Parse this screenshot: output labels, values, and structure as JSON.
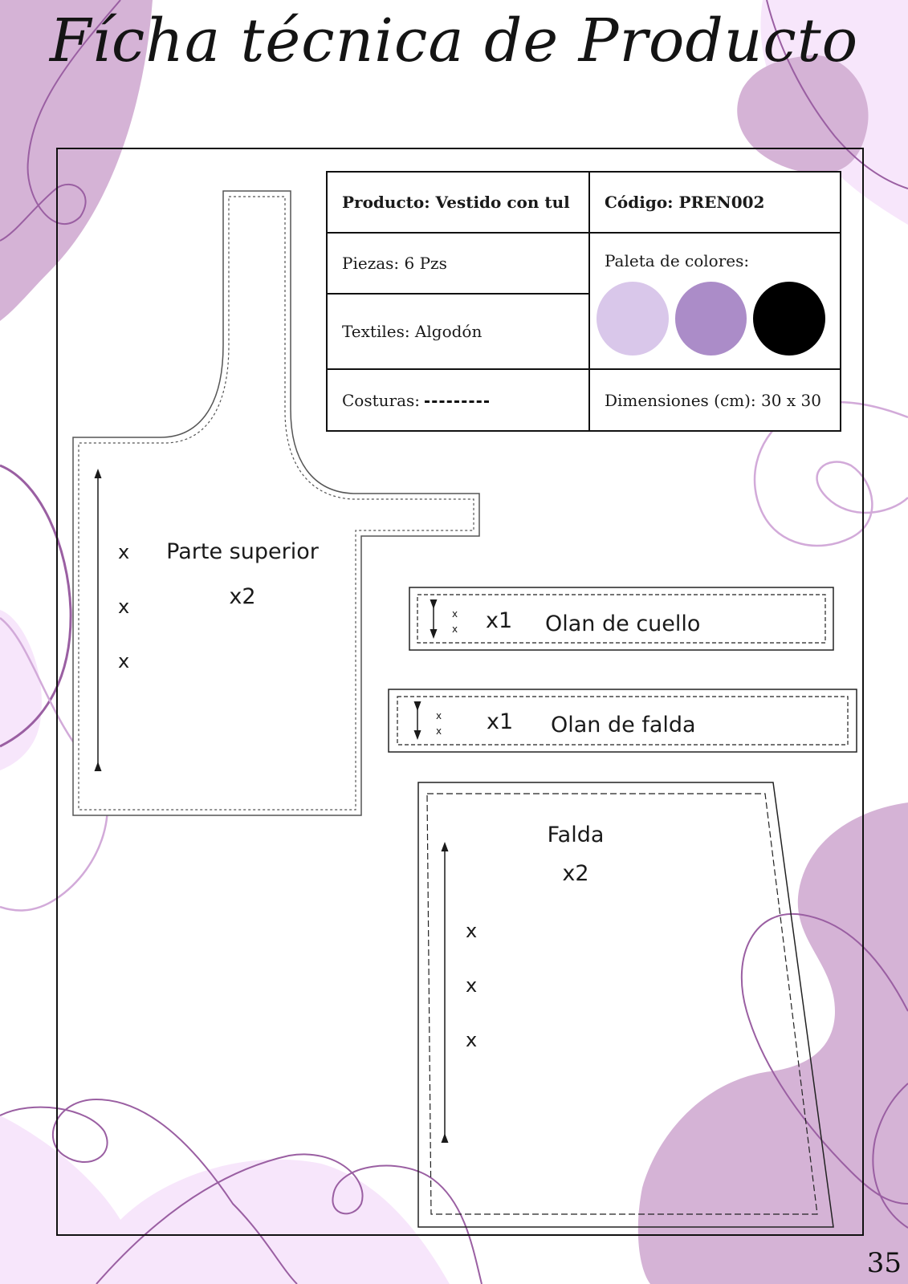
{
  "title": "Fícha técnica de Producto",
  "spec": {
    "producto": "Producto: Vestido con tul",
    "codigo": "Código: PREN002",
    "piezas": "Piezas: 6 Pzs",
    "paleta_label": "Paleta de colores:",
    "textiles": "Textiles: Algodón",
    "costuras": "Costuras:",
    "dimensiones": "Dimensiones (cm): 30 x 30",
    "palette": [
      "#d9c7ea",
      "#ab8cc8",
      "#000000"
    ]
  },
  "pieces": {
    "top": {
      "name": "Parte superior",
      "qty": "x2",
      "marks": [
        "x",
        "x",
        "x"
      ]
    },
    "collar_ruffle": {
      "name": "Olan de cuello",
      "qty": "x1",
      "marks": [
        "x",
        "x"
      ]
    },
    "skirt_ruffle": {
      "name": "Olan de falda",
      "qty": "x1",
      "marks": [
        "x",
        "x"
      ]
    },
    "skirt": {
      "name": "Falda",
      "qty": "x2",
      "marks": [
        "x",
        "x",
        "x"
      ]
    }
  },
  "page_number": "35",
  "decor_colors": {
    "blob": "#d5b3d6",
    "light": "#f7e6fb",
    "line": "#9a5fa2"
  }
}
